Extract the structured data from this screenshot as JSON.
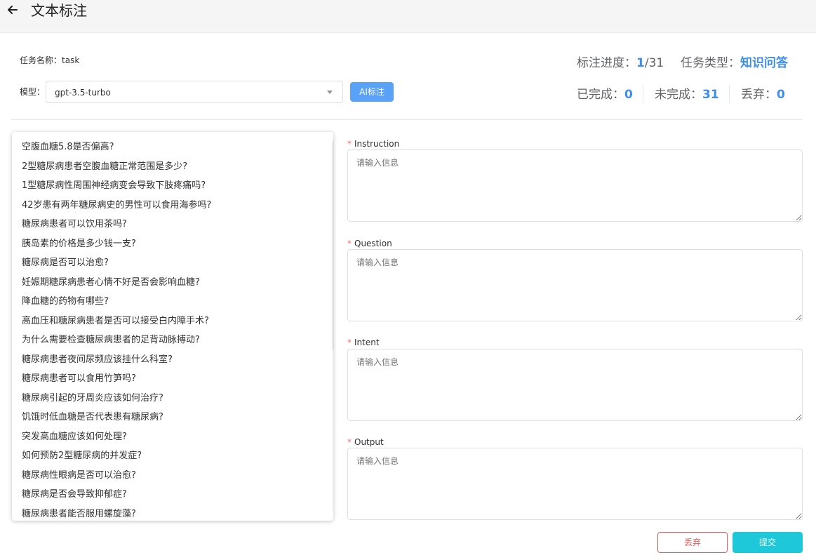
{
  "header": {
    "title": "文本标注"
  },
  "task": {
    "name_label": "任务名称：",
    "name_value": "task"
  },
  "model": {
    "label": "模型：",
    "value": "gpt-3.5-turbo"
  },
  "ai_button": {
    "label": "AI标注"
  },
  "stats": {
    "progress_label": "标注进度：",
    "progress_current": "1",
    "progress_total": "/31",
    "type_label": "任务类型：",
    "type_value": "知识问答",
    "done_label": "已完成：",
    "done_value": "0",
    "undone_label": "未完成：",
    "undone_value": "31",
    "discard_label": "丢弃：",
    "discard_value": "0"
  },
  "questions": [
    "空腹血糖5.8是否偏高?",
    "2型糖尿病患者空腹血糖正常范围是多少?",
    "1型糖尿病性周围神经病变会导致下肢疼痛吗?",
    "42岁患有两年糖尿病史的男性可以食用海参吗?",
    "糖尿病患者可以饮用茶吗?",
    "胰岛素的价格是多少钱一支?",
    "糖尿病是否可以治愈?",
    "妊娠期糖尿病患者心情不好是否会影响血糖?",
    "降血糖的药物有哪些?",
    "高血压和糖尿病患者是否可以接受白内障手术?",
    "为什么需要检查糖尿病患者的足背动脉搏动?",
    "糖尿病患者夜间尿频应该挂什么科室?",
    "糖尿病患者可以食用竹笋吗?",
    "糖尿病引起的牙周炎应该如何治疗?",
    "饥饿时低血糖是否代表患有糖尿病?",
    "突发高血糖应该如何处理?",
    "如何预防2型糖尿病的并发症?",
    "糖尿病性眼病是否可以治愈?",
    "糖尿病是否会导致抑郁症?",
    "糖尿病患者能否服用螺旋藻?"
  ],
  "fields": {
    "required_mark": "*",
    "instruction_label": "Instruction",
    "question_label": "Question",
    "intent_label": "Intent",
    "output_label": "Output",
    "placeholder": "请输入信息"
  },
  "actions": {
    "discard_label": "丢弃",
    "submit_label": "提交"
  },
  "colors": {
    "accent": "#3d8ee8",
    "ai_button": "#5aa2f7",
    "submit": "#1fc8d8",
    "discard": "#e05a5a",
    "required": "#f56c6c"
  },
  "icons": {
    "back": "arrow-left-icon",
    "caret": "caret-down-icon"
  }
}
